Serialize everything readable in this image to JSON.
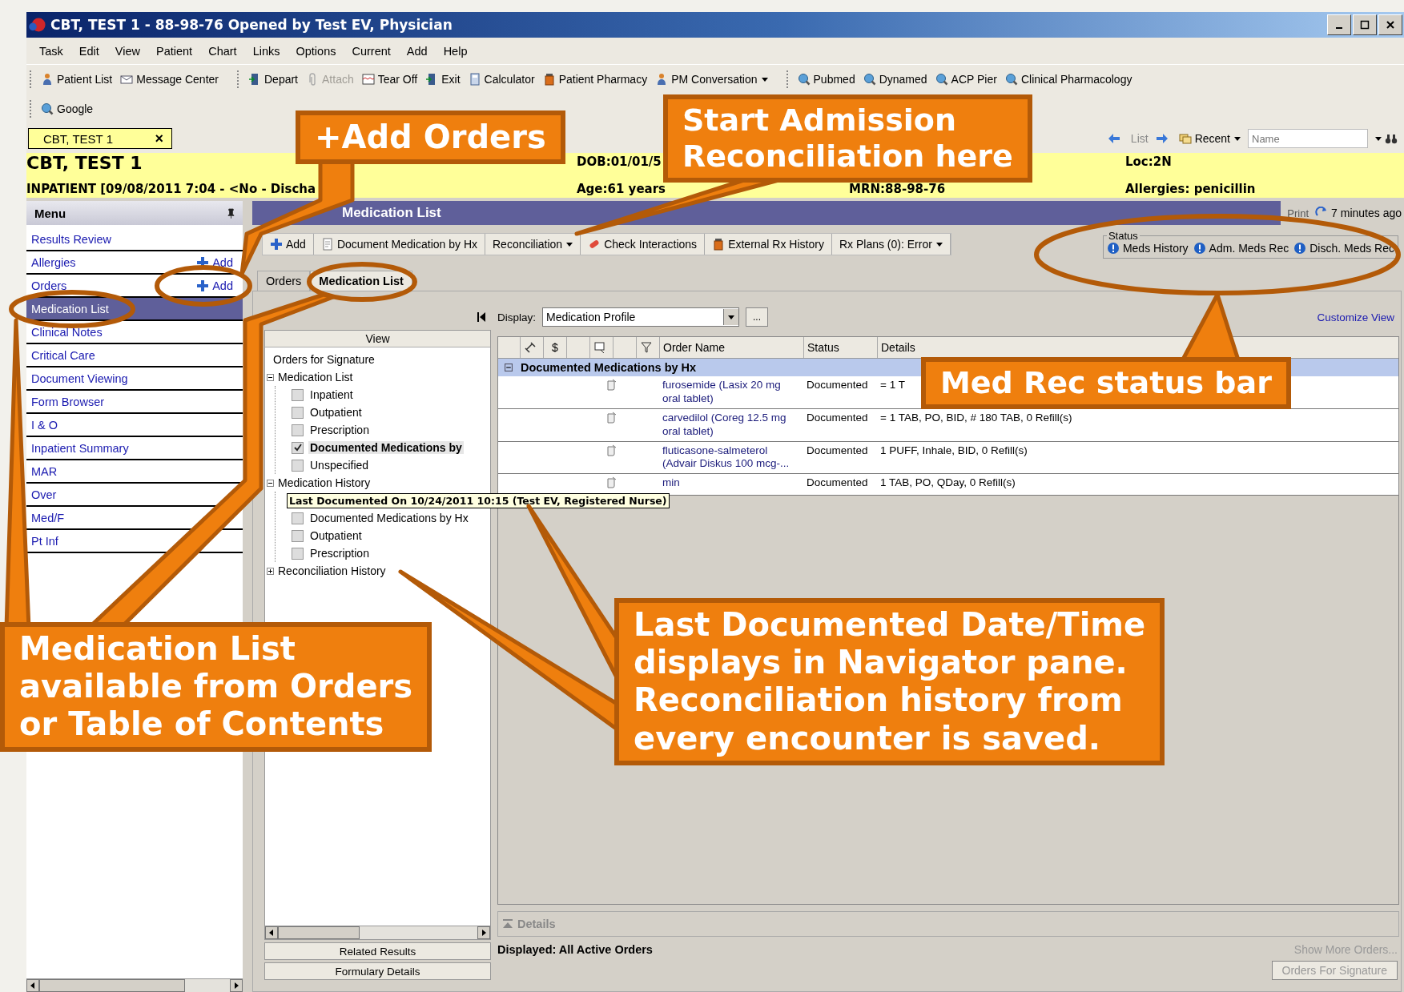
{
  "window": {
    "title": "CBT, TEST 1 - 88-98-76 Opened by Test EV, Physician"
  },
  "menu_bar": [
    "Task",
    "Edit",
    "View",
    "Patient",
    "Chart",
    "Links",
    "Options",
    "Current",
    "Add",
    "Help"
  ],
  "toolbar_groups": [
    [
      {
        "label": "Patient List",
        "disabled": false,
        "dropdown": false
      },
      {
        "label": "Message Center",
        "disabled": false,
        "dropdown": false
      }
    ],
    [
      {
        "label": "Depart",
        "disabled": false,
        "dropdown": false
      },
      {
        "label": "Attach",
        "disabled": true,
        "dropdown": false
      },
      {
        "label": "Tear Off",
        "disabled": false,
        "dropdown": false
      },
      {
        "label": "Exit",
        "disabled": false,
        "dropdown": false
      },
      {
        "label": "Calculator",
        "disabled": false,
        "dropdown": false
      },
      {
        "label": "Patient Pharmacy",
        "disabled": false,
        "dropdown": false
      },
      {
        "label": "PM Conversation",
        "disabled": false,
        "dropdown": true
      }
    ],
    [
      {
        "label": "Pubmed",
        "disabled": false,
        "dropdown": false
      },
      {
        "label": "Dynamed",
        "disabled": false,
        "dropdown": false
      },
      {
        "label": "ACP Pier",
        "disabled": false,
        "dropdown": false
      },
      {
        "label": "Clinical Pharmacology",
        "disabled": false,
        "dropdown": false
      }
    ]
  ],
  "google_toolbar": {
    "label": "Google"
  },
  "patient_tab": {
    "label": "CBT, TEST 1",
    "close": "×"
  },
  "patient_toolbar": {
    "list": "List",
    "recent": "Recent",
    "placeholder": "Name"
  },
  "banner": {
    "name": "CBT, TEST 1",
    "encounter": "INPATIENT [09/08/2011 7:04 - <No - Discha",
    "dob": "DOB:01/01/5",
    "age": "Age:61 years",
    "mrn": "MRN:88-98-76",
    "location": "Loc:2N",
    "allergies": "Allergies: penicillin"
  },
  "menu_panel": {
    "title": "Menu",
    "items": [
      {
        "label": "Results Review",
        "selected": false
      },
      {
        "label": "Allergies",
        "selected": false,
        "action": "Add"
      },
      {
        "label": "Orders",
        "selected": false,
        "action": "Add"
      },
      {
        "label": "Medication List",
        "selected": true
      },
      {
        "label": "Clinical Notes",
        "selected": false
      },
      {
        "label": "Critical Care",
        "selected": false
      },
      {
        "label": "Document Viewing",
        "selected": false
      },
      {
        "label": "Form Browser",
        "selected": false
      },
      {
        "label": "I & O",
        "selected": false
      },
      {
        "label": "Inpatient Summary",
        "selected": false
      },
      {
        "label": "MAR",
        "selected": false
      },
      {
        "label": "Over",
        "selected": false
      },
      {
        "label": "Med/F",
        "selected": false
      },
      {
        "label": "Pt Inf",
        "selected": false
      }
    ]
  },
  "content_header": {
    "title": "Medication List",
    "print": "Print",
    "updated": "7 minutes ago"
  },
  "content_toolbar": [
    {
      "label": "Add",
      "dropdown": false
    },
    {
      "label": "Document Medication by Hx",
      "dropdown": false
    },
    {
      "label": "Reconciliation",
      "dropdown": true
    },
    {
      "label": "Check Interactions",
      "dropdown": false
    },
    {
      "label": "External Rx History",
      "dropdown": false
    },
    {
      "label": "Rx Plans (0): Error",
      "dropdown": true
    }
  ],
  "status": {
    "legend": "Status",
    "items": [
      "Meds History",
      "Adm. Meds Rec",
      "Disch. Meds Rec"
    ]
  },
  "tabs": [
    {
      "label": "Orders",
      "selected": false
    },
    {
      "label": "Medication List",
      "selected": true
    }
  ],
  "navigator": {
    "header": "View",
    "nodes": [
      {
        "kind": "plain",
        "label": "Orders for Signature"
      },
      {
        "kind": "folder",
        "label": "Medication List",
        "expanded": true,
        "children": [
          {
            "kind": "checkbox",
            "label": "Inpatient",
            "checked": false,
            "selected": false
          },
          {
            "kind": "checkbox",
            "label": "Outpatient",
            "checked": false,
            "selected": false
          },
          {
            "kind": "checkbox",
            "label": "Prescription",
            "checked": false,
            "selected": false
          },
          {
            "kind": "checkbox",
            "label": "Documented Medications by",
            "checked": true,
            "selected": true
          },
          {
            "kind": "checkbox",
            "label": "Unspecified",
            "checked": false,
            "selected": false
          }
        ]
      },
      {
        "kind": "folder",
        "label": "Medication History",
        "expanded": true,
        "children": [
          {
            "kind": "tooltip",
            "label": "Last Documented On 10/24/2011 10:15 (Test EV, Registered Nurse)"
          },
          {
            "kind": "checkbox",
            "label": "Documented Medications by Hx",
            "checked": false,
            "selected": false
          },
          {
            "kind": "checkbox",
            "label": "Outpatient",
            "checked": false,
            "selected": false
          },
          {
            "kind": "checkbox",
            "label": "Prescription",
            "checked": false,
            "selected": false
          }
        ]
      },
      {
        "kind": "folder",
        "label": "Reconciliation History",
        "expanded": false
      }
    ],
    "footer_buttons": [
      "Related Results",
      "Formulary Details"
    ]
  },
  "display": {
    "label": "Display:",
    "value": "Medication Profile",
    "more": "...",
    "customize": "Customize View"
  },
  "grid": {
    "dollar": "$",
    "columns": [
      "Order Name",
      "Status",
      "Details"
    ],
    "groups": [
      {
        "label": "Documented Medications by Hx",
        "expanded": true,
        "rows": [
          {
            "name": "furosemide (Lasix 20 mg oral tablet)",
            "status": "Documented",
            "details": "= 1 T"
          },
          {
            "name": "carvedilol (Coreg 12.5 mg oral tablet)",
            "status": "Documented",
            "details": "= 1 TAB, PO, BID, # 180 TAB, 0 Refill(s)"
          },
          {
            "name": "fluticasone-salmeterol (Advair Diskus 100 mcg-...",
            "status": "Documented",
            "details": "1 PUFF, Inhale, BID, 0 Refill(s)"
          },
          {
            "name": "min",
            "status": "Documented",
            "details": "1 TAB, PO, QDay, 0 Refill(s)"
          }
        ]
      }
    ]
  },
  "details_panel": {
    "label": "Details"
  },
  "footer": {
    "displayed": "Displayed: All Active Orders",
    "show_more": "Show More Orders...",
    "sign": "Orders For Signature"
  },
  "callouts": [
    {
      "lines": [
        "+Add Orders"
      ]
    },
    {
      "lines": [
        "Start Admission",
        "Reconciliation here"
      ]
    },
    {
      "lines": [
        "Med Rec status bar"
      ]
    },
    {
      "lines": [
        "Medication List",
        "available from Orders",
        "or Table of Contents"
      ]
    },
    {
      "lines": [
        "Last Documented Date/Time",
        "displays in Navigator pane.",
        "Reconciliation history from",
        "every encounter is saved."
      ]
    }
  ]
}
